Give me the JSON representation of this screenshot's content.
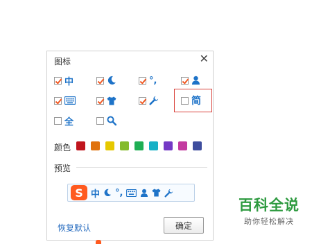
{
  "dialog": {
    "title": "图标",
    "close_glyph": "✕",
    "icon_options": [
      {
        "icon": "zhong-icon",
        "glyph": "中",
        "checked": true
      },
      {
        "icon": "moon-icon",
        "glyph": "",
        "checked": true
      },
      {
        "icon": "punctuation-icon",
        "glyph": "°,",
        "checked": true
      },
      {
        "icon": "user-icon",
        "glyph": "",
        "checked": true
      },
      {
        "icon": "keyboard-icon",
        "glyph": "",
        "checked": true
      },
      {
        "icon": "tshirt-icon",
        "glyph": "",
        "checked": true
      },
      {
        "icon": "wrench-icon",
        "glyph": "",
        "checked": true
      },
      {
        "icon": "jian-icon",
        "glyph": "简",
        "checked": false
      },
      {
        "icon": "quan-icon",
        "glyph": "全",
        "checked": false
      },
      {
        "icon": "search-icon",
        "glyph": "",
        "checked": false
      }
    ],
    "color_label": "颜色",
    "colors": [
      "#c0151d",
      "#e0720e",
      "#e6c800",
      "#84bb2b",
      "#1fae54",
      "#17b0c6",
      "#7439c5",
      "#c33aa0",
      "#3e4d9d"
    ],
    "preview_label": "预览",
    "preview": {
      "logo_letter": "S",
      "zhong": "中",
      "punct": "°,"
    },
    "restore_default": "恢复默认",
    "confirm": "确定"
  },
  "watermark": {
    "title": "百科全说",
    "subtitle": "助你轻松解决"
  },
  "accent_color": "#1e73c8",
  "check_color": "#f15a24"
}
